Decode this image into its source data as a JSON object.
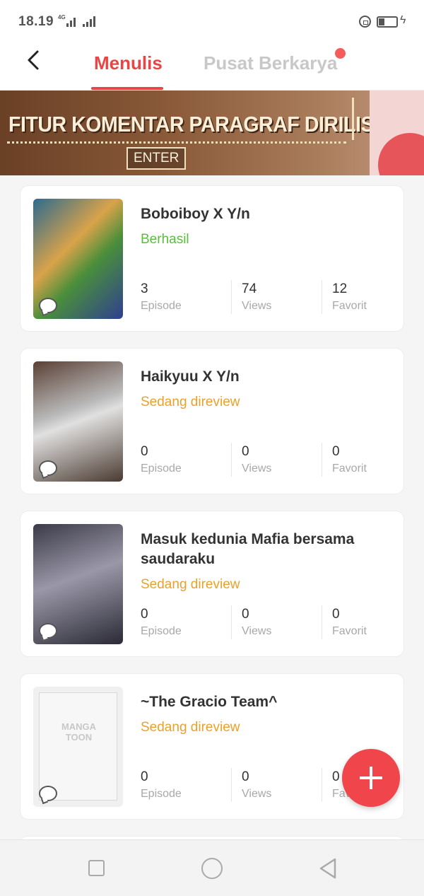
{
  "status_bar": {
    "time": "18.19",
    "network": "4G"
  },
  "header": {
    "tab_active": "Menulis",
    "tab_inactive": "Pusat Berkarya"
  },
  "banner": {
    "title": "FITUR KOMENTAR PARAGRAF DIRILIS!",
    "button": "ENTER"
  },
  "works": [
    {
      "title": "Boboiboy X Y/n",
      "status": "Berhasil",
      "episode": "3",
      "views": "74",
      "favorit": "12"
    },
    {
      "title": "Haikyuu X Y/n",
      "status": "Sedang direview",
      "episode": "0",
      "views": "0",
      "favorit": "0"
    },
    {
      "title": "Masuk kedunia Mafia bersama saudaraku",
      "status": "Sedang direview",
      "episode": "0",
      "views": "0",
      "favorit": "0"
    },
    {
      "title": "~The Gracio Team^",
      "status": "Sedang direview",
      "episode": "0",
      "views": "0",
      "favorit": "0"
    }
  ],
  "labels": {
    "episode": "Episode",
    "views": "Views",
    "favorit": "Favorit"
  },
  "placeholder_cover": {
    "line1": "MANGA",
    "line2": "TOON"
  },
  "colors": {
    "accent": "#e94545",
    "success": "#5bbd3f",
    "pending": "#eaa12c"
  },
  "icons": {
    "back": "chevron-left-icon",
    "add": "plus-icon",
    "comment": "comment-icon"
  }
}
